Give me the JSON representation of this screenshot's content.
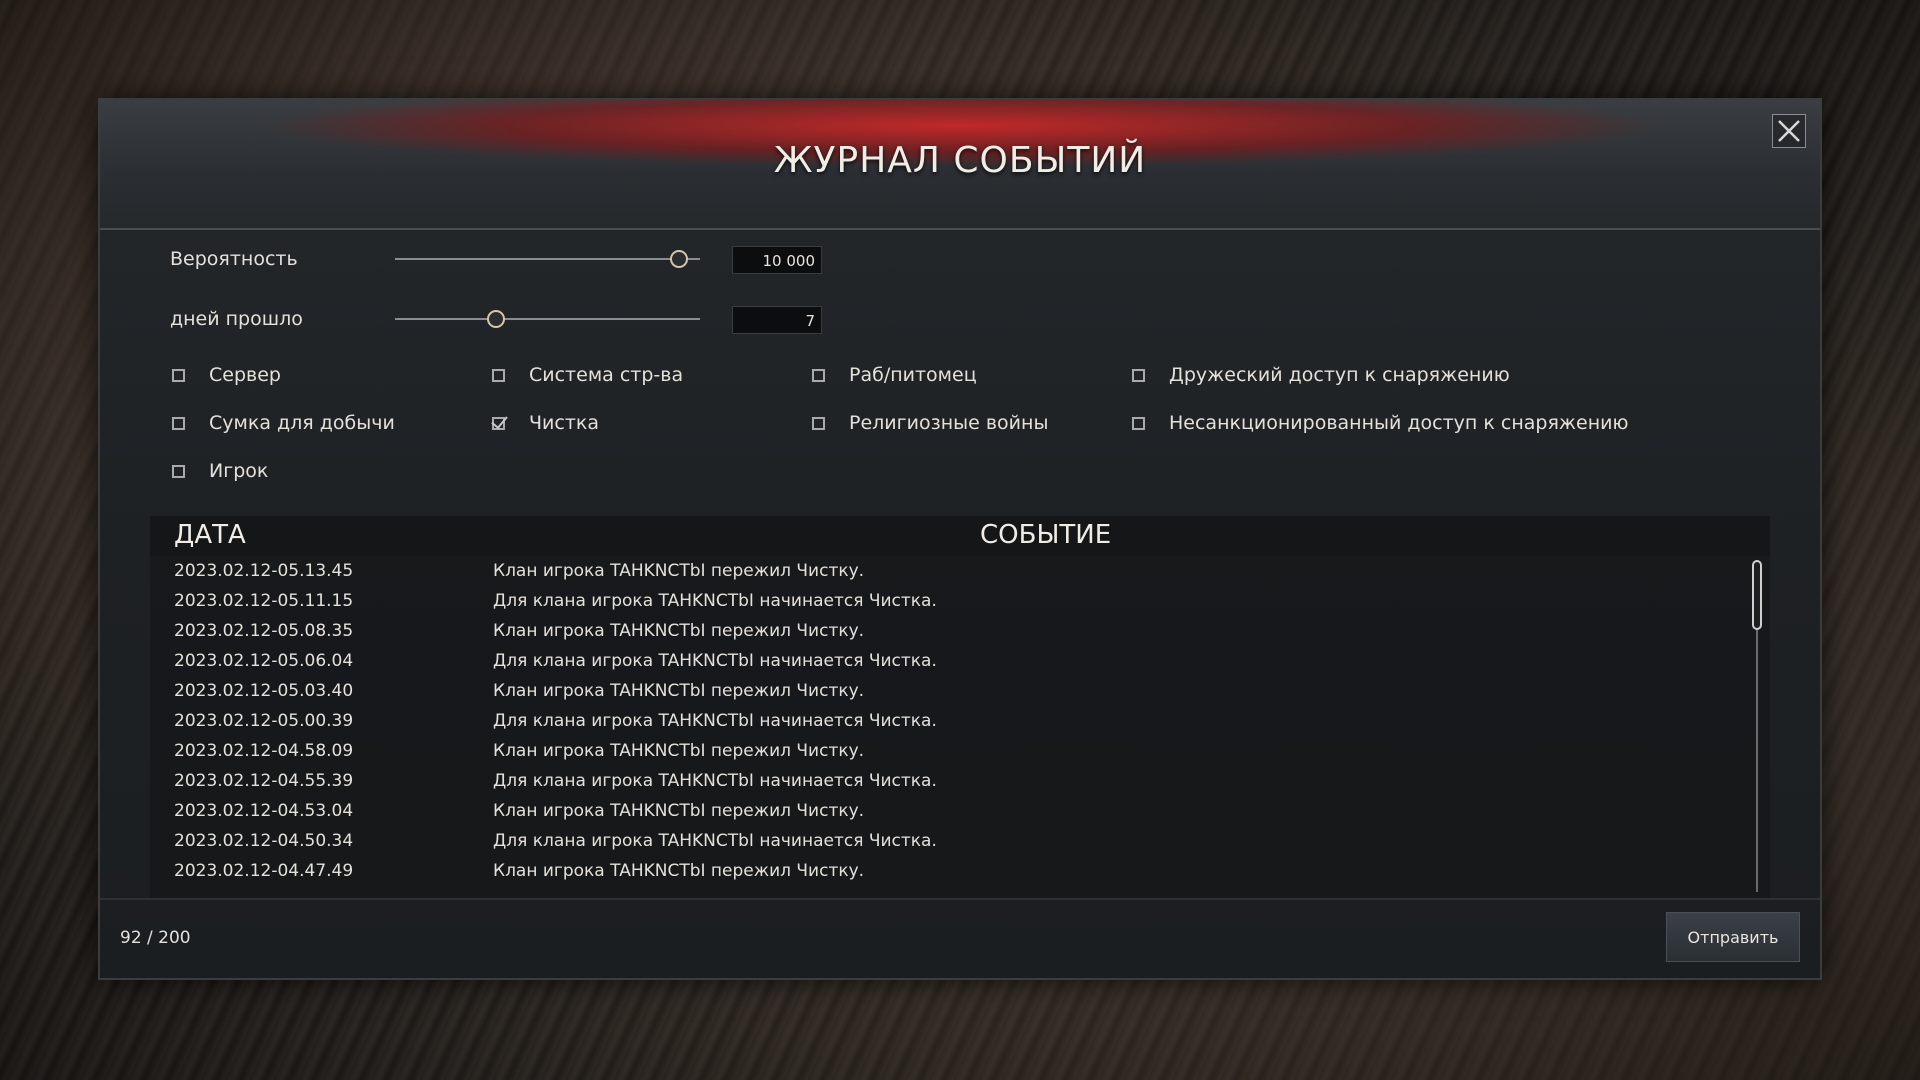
{
  "dialog": {
    "title": "ЖУРНАЛ СОБЫТИЙ",
    "close_icon": "close-icon"
  },
  "controls": {
    "probability": {
      "label": "Вероятность",
      "value": "10 000",
      "slider_fraction": 0.93
    },
    "days": {
      "label": "дней прошло",
      "value": "7",
      "slider_fraction": 0.33
    }
  },
  "filters": [
    {
      "label": "Сервер",
      "checked": false
    },
    {
      "label": "Система стр-ва",
      "checked": false
    },
    {
      "label": "Раб/питомец",
      "checked": false
    },
    {
      "label": "Дружеский доступ к снаряжению",
      "checked": false
    },
    {
      "label": "Сумка для добычи",
      "checked": false
    },
    {
      "label": "Чистка",
      "checked": true
    },
    {
      "label": "Религиозные войны",
      "checked": false
    },
    {
      "label": "Несанкционированный доступ к снаряжению",
      "checked": false
    },
    {
      "label": "Игрок",
      "checked": false
    }
  ],
  "log": {
    "col_date": "ДАТА",
    "col_event": "СОБЫТИЕ",
    "rows": [
      {
        "date": "2023.02.12-05.13.45",
        "event": "Клан игрока TAHKNCTbI пережил Чистку."
      },
      {
        "date": "2023.02.12-05.11.15",
        "event": "Для клана игрока TAHKNCTbI начинается Чистка."
      },
      {
        "date": "2023.02.12-05.08.35",
        "event": "Клан игрока TAHKNCTbI пережил Чистку."
      },
      {
        "date": "2023.02.12-05.06.04",
        "event": "Для клана игрока TAHKNCTbI начинается Чистка."
      },
      {
        "date": "2023.02.12-05.03.40",
        "event": "Клан игрока TAHKNCTbI пережил Чистку."
      },
      {
        "date": "2023.02.12-05.00.39",
        "event": "Для клана игрока TAHKNCTbI начинается Чистка."
      },
      {
        "date": "2023.02.12-04.58.09",
        "event": "Клан игрока TAHKNCTbI пережил Чистку."
      },
      {
        "date": "2023.02.12-04.55.39",
        "event": "Для клана игрока TAHKNCTbI начинается Чистка."
      },
      {
        "date": "2023.02.12-04.53.04",
        "event": "Клан игрока TAHKNCTbI пережил Чистку."
      },
      {
        "date": "2023.02.12-04.50.34",
        "event": "Для клана игрока TAHKNCTbI начинается Чистка."
      },
      {
        "date": "2023.02.12-04.47.49",
        "event": "Клан игрока TAHKNCTbI пережил Чистку."
      }
    ]
  },
  "footer": {
    "counter": "92 / 200",
    "send_label": "Отправить"
  }
}
